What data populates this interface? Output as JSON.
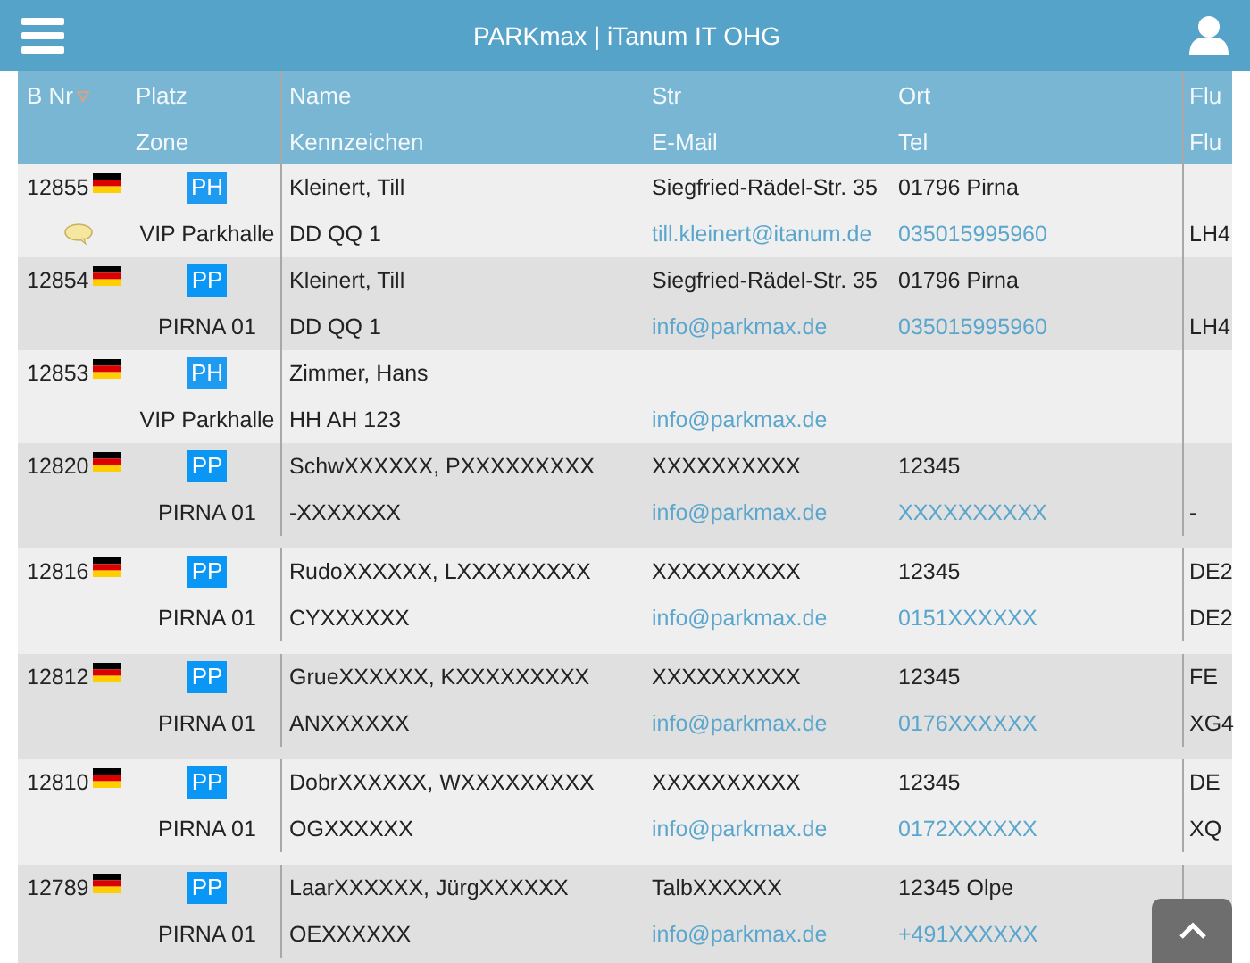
{
  "header": {
    "title": "PARKmax | iTanum IT OHG"
  },
  "table": {
    "columns": [
      {
        "top": "B Nr"
      },
      {
        "top": "Platz",
        "bottom": "Zone"
      },
      {
        "top": "Name",
        "bottom": "Kennzeichen"
      },
      {
        "top": "Str",
        "bottom": "E-Mail"
      },
      {
        "top": "Ort",
        "bottom": "Tel"
      },
      {
        "top": "Flu",
        "bottom": "Flu"
      }
    ],
    "rows": [
      {
        "number": "12855",
        "comment": true,
        "zone_badge": "PH",
        "zone": "VIP Parkhalle",
        "name": "Kleinert, Till",
        "plate": "DD QQ 1",
        "street": "Siegfried-Rädel-Str. 35",
        "email": "till.kleinert@itanum.de",
        "city": "01796 Pirna",
        "tel": "035015995960",
        "column_6_line_2": "LH4"
      },
      {
        "number": "12854",
        "comment": false,
        "zone_badge": "PP",
        "zone": "PIRNA 01",
        "name": "Kleinert, Till",
        "plate": "DD QQ 1",
        "street": "Siegfried-Rädel-Str. 35",
        "email": "info@parkmax.de",
        "city": "01796 Pirna",
        "tel": "035015995960",
        "column_6_line_2": "LH4"
      },
      {
        "number": "12853",
        "comment": false,
        "zone_badge": "PH",
        "zone": "VIP Parkhalle",
        "name": "Zimmer, Hans",
        "plate": "HH AH 123",
        "email": "info@parkmax.de"
      },
      {
        "number": "12820",
        "comment": false,
        "zone_badge": "PP",
        "zone": "PIRNA 01",
        "name": "SchwXXXXXX, PXXXXXXXXX",
        "plate": "-XXXXXXX",
        "street": "XXXXXXXXXX",
        "email": "info@parkmax.de",
        "city": "12345",
        "tel": "XXXXXXXXXX",
        "column_6_line_2": "-"
      },
      {
        "number": "12816",
        "comment": false,
        "zone_badge": "PP",
        "zone": "PIRNA 01",
        "name": "RudoXXXXXX, LXXXXXXXXX",
        "plate": "CYXXXXXX",
        "street": "XXXXXXXXXX",
        "email": "info@parkmax.de",
        "city": "12345",
        "tel": "0151XXXXXX",
        "column_6_line_1": "DE2",
        "column_6_line_2": "DE2"
      },
      {
        "number": "12812",
        "comment": false,
        "zone_badge": "PP",
        "zone": "PIRNA 01",
        "name": "GrueXXXXXX, KXXXXXXXXX",
        "plate": "ANXXXXXX",
        "street": "XXXXXXXXXX",
        "email": "info@parkmax.de",
        "city": "12345",
        "tel": "0176XXXXXX",
        "column_6_line_1": "FE",
        "column_6_line_2": "XG4"
      },
      {
        "number": "12810",
        "comment": false,
        "zone_badge": "PP",
        "zone": "PIRNA 01",
        "name": "DobrXXXXXX, WXXXXXXXXX",
        "plate": "OGXXXXXX",
        "street": "XXXXXXXXXX",
        "email": "info@parkmax.de",
        "city": "12345",
        "tel": "0172XXXXXX",
        "column_6_line_1": "DE",
        "column_6_line_2": "XQ"
      },
      {
        "number": "12789",
        "comment": false,
        "zone_badge": "PP",
        "zone": "PIRNA 01",
        "name": "LaarXXXXXX, JürgXXXXXX",
        "plate": "OEXXXXXX",
        "street": "TalbXXXXXX",
        "email": "info@parkmax.de",
        "city": "12345 Olpe",
        "tel": "+491XXXXXX"
      }
    ]
  }
}
